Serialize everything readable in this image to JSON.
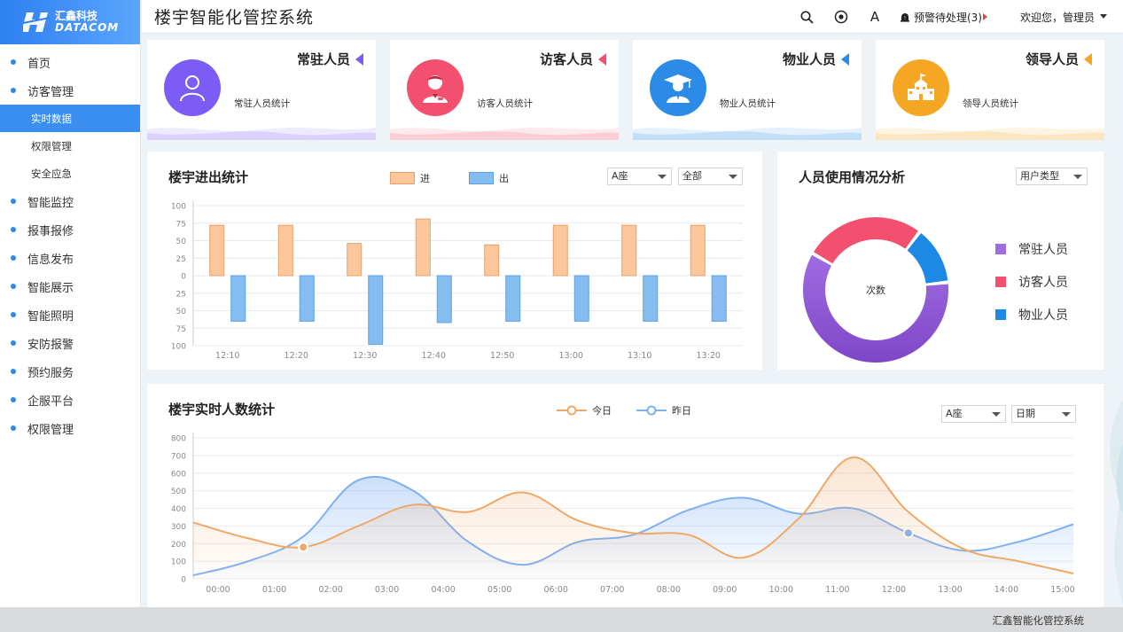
{
  "logo": {
    "line1": "汇鑫科技",
    "line2": "DATACOM"
  },
  "sidebar": {
    "items": [
      {
        "label": "首页",
        "level": "top"
      },
      {
        "label": "访客管理",
        "level": "top"
      },
      {
        "label": "实时数据",
        "level": "sub",
        "active": true
      },
      {
        "label": "权限管理",
        "level": "sub"
      },
      {
        "label": "安全应急",
        "level": "sub"
      },
      {
        "label": "智能监控",
        "level": "top"
      },
      {
        "label": "报事报修",
        "level": "top"
      },
      {
        "label": "信息发布",
        "level": "top"
      },
      {
        "label": "智能展示",
        "level": "top"
      },
      {
        "label": "智能照明",
        "level": "top"
      },
      {
        "label": "安防报警",
        "level": "top"
      },
      {
        "label": "预约服务",
        "level": "top"
      },
      {
        "label": "企服平台",
        "level": "top"
      },
      {
        "label": "权限管理",
        "level": "top"
      }
    ]
  },
  "header": {
    "title": "楼宇智能化管控系统",
    "font_label": "A",
    "alarm_label": "预警待处理(3)",
    "welcome": "欢迎您，管理员"
  },
  "cards": [
    {
      "title": "常驻人员",
      "subtitle": "常驻人员统计",
      "color": "#7b5cf5",
      "icon": "person-icon"
    },
    {
      "title": "访客人员",
      "subtitle": "访客人员统计",
      "color": "#f2506e",
      "icon": "visitor-icon"
    },
    {
      "title": "物业人员",
      "subtitle": "物业人员统计",
      "color": "#2b8be6",
      "icon": "graduate-icon"
    },
    {
      "title": "领导人员",
      "subtitle": "领导人员统计",
      "color": "#f5a623",
      "icon": "building-icon"
    }
  ],
  "inout": {
    "title": "楼宇进出统计",
    "legend_in": "进",
    "legend_out": "出",
    "select_building": "A座",
    "select_scope": "全部"
  },
  "usage": {
    "title": "人员使用情况分析",
    "select_type": "用户类型",
    "center_label": "次数",
    "legend": [
      {
        "label": "常驻人员",
        "color": "#9b6fe0"
      },
      {
        "label": "访客人员",
        "color": "#f2506e"
      },
      {
        "label": "物业人员",
        "color": "#1e88e5"
      }
    ]
  },
  "realtime": {
    "title": "楼宇实时人数统计",
    "legend_today": "今日",
    "legend_yesterday": "昨日",
    "select_building": "A座",
    "select_date": "日期"
  },
  "footer": {
    "text": "汇鑫智能化管控系统"
  },
  "chart_data": [
    {
      "type": "bar",
      "title": "楼宇进出统计",
      "categories": [
        "12:10",
        "12:20",
        "12:30",
        "12:40",
        "12:50",
        "13:00",
        "13:10",
        "13:20"
      ],
      "y_ticks": [
        "100",
        "75",
        "50",
        "25",
        "0",
        "25",
        "50",
        "75",
        "100"
      ],
      "ylim": [
        -100,
        100
      ],
      "series": [
        {
          "name": "进",
          "color": "#fcc79b",
          "values": [
            72,
            72,
            46,
            81,
            44,
            72,
            72,
            72
          ]
        },
        {
          "name": "出",
          "color": "#85bdf0",
          "values": [
            -65,
            -65,
            -98,
            -67,
            -65,
            -65,
            -65,
            -65
          ]
        }
      ]
    },
    {
      "type": "pie",
      "title": "人员使用情况分析",
      "labels": [
        "常驻人员",
        "访客人员",
        "物业人员"
      ],
      "values": [
        60,
        27,
        13
      ],
      "colors": [
        "#9b6fe0",
        "#f2506e",
        "#1e88e5"
      ]
    },
    {
      "type": "line",
      "title": "楼宇实时人数统计",
      "x": [
        "00:00",
        "01:00",
        "02:00",
        "03:00",
        "04:00",
        "05:00",
        "06:00",
        "07:00",
        "08:00",
        "09:00",
        "10:00",
        "11:00",
        "12:00",
        "13:00",
        "14:00",
        "15:00"
      ],
      "ylim": [
        0,
        800
      ],
      "y_ticks": [
        0,
        100,
        200,
        300,
        400,
        500,
        600,
        700,
        800
      ],
      "series": [
        {
          "name": "今日",
          "color": "#f0a868",
          "values": [
            320,
            230,
            180,
            300,
            420,
            380,
            490,
            330,
            260,
            250,
            120,
            340,
            690,
            380,
            170,
            100,
            30
          ]
        },
        {
          "name": "昨日",
          "color": "#7fb0f2",
          "values": [
            20,
            100,
            240,
            560,
            500,
            210,
            80,
            210,
            250,
            390,
            460,
            370,
            400,
            260,
            160,
            210,
            310
          ]
        }
      ]
    }
  ]
}
